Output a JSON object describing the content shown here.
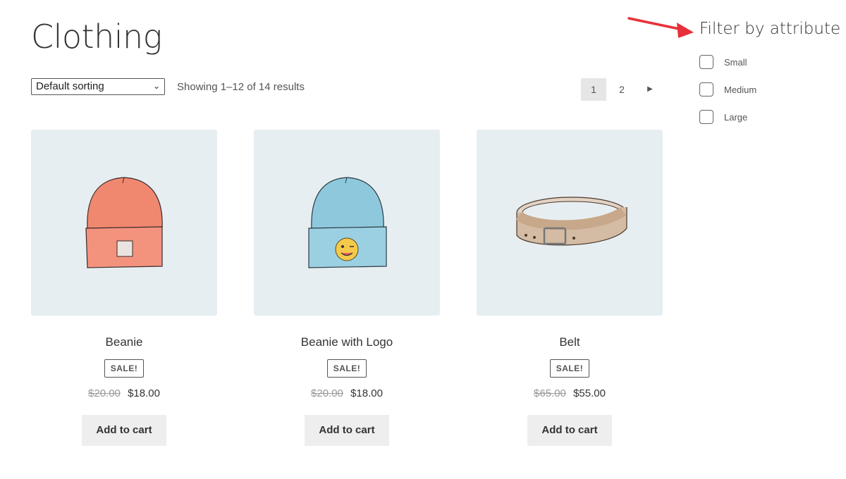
{
  "page": {
    "title": "Clothing"
  },
  "toolbar": {
    "sort_value": "Default sorting",
    "result_count": "Showing 1–12 of 14 results"
  },
  "pagination": {
    "pages": [
      "1",
      "2"
    ],
    "current_page": "1",
    "next_icon": "triangle-right-icon"
  },
  "products": [
    {
      "name": "Beanie",
      "badge": "SALE!",
      "old_price": "$20.00",
      "price": "$18.00",
      "button": "Add to cart"
    },
    {
      "name": "Beanie with Logo",
      "badge": "SALE!",
      "old_price": "$20.00",
      "price": "$18.00",
      "button": "Add to cart"
    },
    {
      "name": "Belt",
      "badge": "SALE!",
      "old_price": "$65.00",
      "price": "$55.00",
      "button": "Add to cart"
    }
  ],
  "sidebar": {
    "title": "Filter by attribute",
    "filters": [
      "Small",
      "Medium",
      "Large"
    ]
  },
  "colors": {
    "annotation_arrow": "#e8303a",
    "thumbnail_bg": "#e7eef2",
    "button_bg": "#eeeeee"
  }
}
